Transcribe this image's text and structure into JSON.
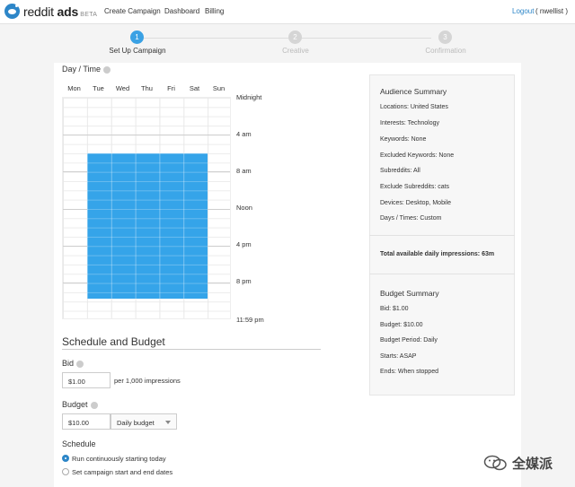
{
  "header": {
    "brand_main": "reddit ",
    "brand_ads": "ads",
    "brand_beta": " BETA",
    "nav": [
      "Create Campaign",
      "Dashboard",
      "Billing"
    ],
    "logout": "Logout",
    "username": "( nwellist )"
  },
  "steps": [
    {
      "number": "1",
      "label": "Set Up Campaign",
      "state": "active"
    },
    {
      "number": "2",
      "label": "Creative",
      "state": "inactive"
    },
    {
      "number": "3",
      "label": "Confirmation",
      "state": "inactive"
    }
  ],
  "day_time": {
    "label": "Day / Time",
    "days": [
      "Mon",
      "Tue",
      "Wed",
      "Thu",
      "Fri",
      "Sat",
      "Sun"
    ],
    "times": [
      "Midnight",
      "4 am",
      "8 am",
      "Noon",
      "4 pm",
      "8 pm",
      "11:59 pm"
    ],
    "selected": {
      "days": "Tue–Sat",
      "hours": "6 am – 9 pm"
    }
  },
  "schedule": {
    "title": "Schedule and Budget",
    "bid_label": "Bid",
    "bid_value": "$1.00",
    "bid_hint": "per 1,000 impressions",
    "budget_label": "Budget",
    "budget_value": "$10.00",
    "budget_type": "Daily budget",
    "schedule_label": "Schedule",
    "options": [
      "Run continuously starting today",
      "Set campaign start and end dates"
    ],
    "selected_option": 0
  },
  "audience_summary": {
    "title": "Audience Summary",
    "lines": [
      "Locations: United States",
      "Interests: Technology",
      "Keywords: None",
      "Excluded Keywords: None",
      "Subreddits: All",
      "Exclude Subreddits: cats",
      "Devices: Desktop, Mobile",
      "Days / Times: Custom"
    ],
    "impressions": "Total available daily impressions: 63m"
  },
  "budget_summary": {
    "title": "Budget Summary",
    "lines": [
      "Bid: $1.00",
      "Budget: $10.00",
      "Budget Period: Daily",
      "Starts: ASAP",
      "Ends: When stopped"
    ]
  },
  "watermark": {
    "text": "全媒派"
  },
  "colors": {
    "accent": "#35a4e9",
    "link": "#2d86c8"
  }
}
